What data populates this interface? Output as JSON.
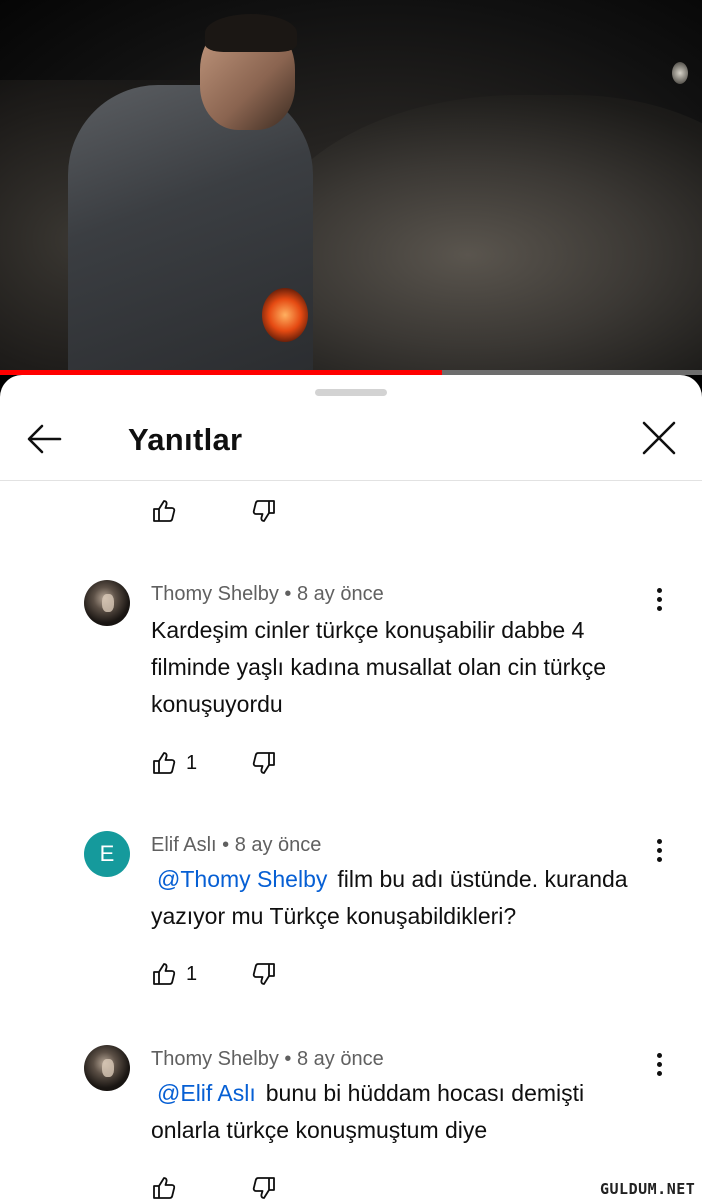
{
  "video": {
    "progress": 0.63
  },
  "sheet": {
    "title": "Yanıtlar",
    "back_icon": "arrow-left-icon",
    "close_icon": "close-icon"
  },
  "comments": [
    {
      "author": "Thomy Shelby",
      "time": "• 8 ay önce",
      "avatar": "photo",
      "mention": "",
      "lines": [
        "Kardeşim cinler türkçe konuşabilir dabbe 4",
        "filminde yaşlı kadına musallat olan cin türkçe",
        "konuşuyordu"
      ],
      "likes": "1"
    },
    {
      "author": "Elif Aslı",
      "time": "• 8 ay önce",
      "avatar_letter": "E",
      "avatar_color": "#159a9c",
      "mention": "@Thomy Shelby",
      "lines": [
        "film bu adı üstünde. kuranda",
        "yazıyor mu Türkçe konuşabildikleri?"
      ],
      "likes": "1"
    },
    {
      "author": "Thomy Shelby",
      "time": "• 8 ay önce",
      "avatar": "photo",
      "mention": "@Elif Aslı",
      "lines": [
        "bunu bi hüddam hocası demişti",
        "onlarla türkçe konuşmuştum diye"
      ],
      "likes": ""
    }
  ],
  "watermark": "GULDUM.NET",
  "colors": {
    "mention": "#065fd4",
    "progress": "#ff0000",
    "avatar_e": "#159a9c"
  }
}
